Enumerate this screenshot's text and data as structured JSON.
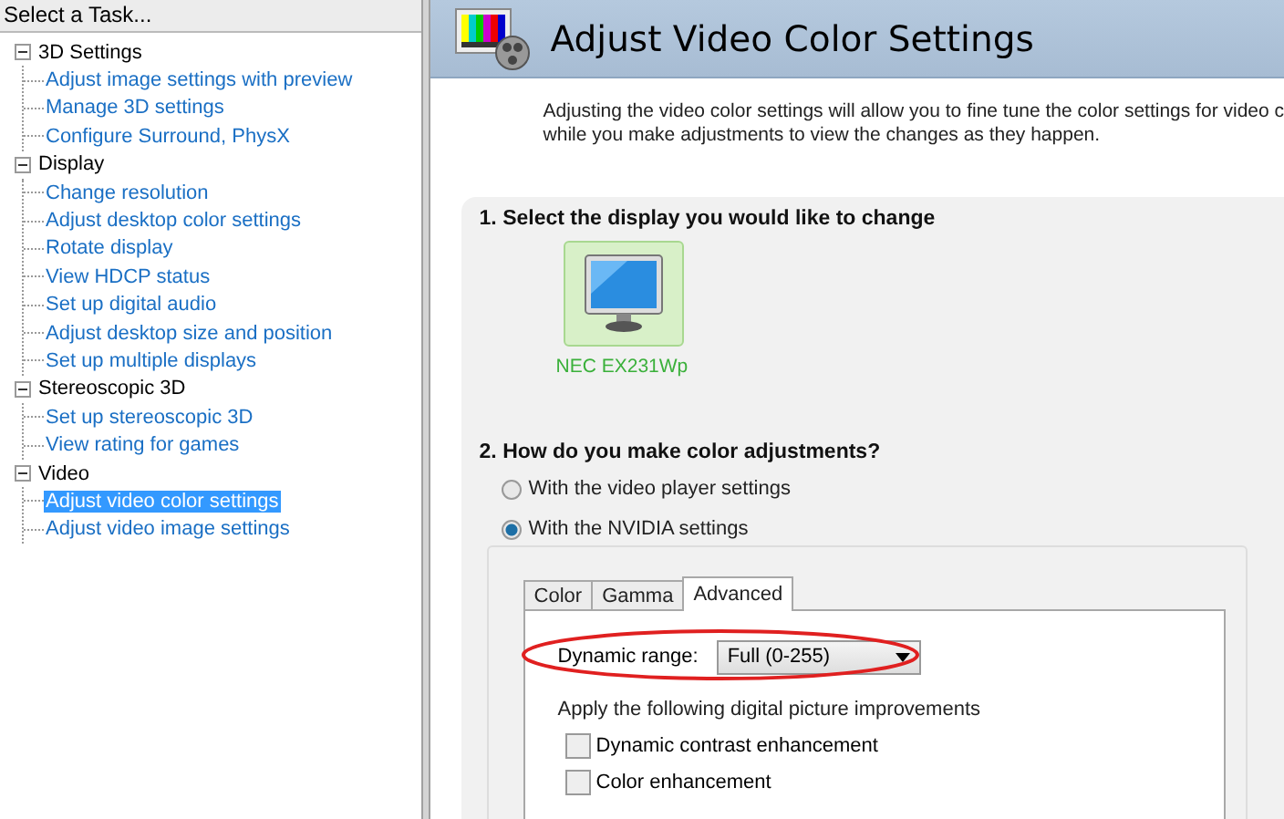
{
  "task_panel": {
    "title": "Select a Task...",
    "tree": [
      {
        "label": "3D Settings",
        "expanded": true,
        "children": [
          {
            "label": "Adjust image settings with preview",
            "selected": false
          },
          {
            "label": "Manage 3D settings",
            "selected": false
          },
          {
            "label": "Configure Surround, PhysX",
            "selected": false
          }
        ]
      },
      {
        "label": "Display",
        "expanded": true,
        "children": [
          {
            "label": "Change resolution",
            "selected": false
          },
          {
            "label": "Adjust desktop color settings",
            "selected": false
          },
          {
            "label": "Rotate display",
            "selected": false
          },
          {
            "label": "View HDCP status",
            "selected": false
          },
          {
            "label": "Set up digital audio",
            "selected": false
          },
          {
            "label": "Adjust desktop size and position",
            "selected": false
          },
          {
            "label": "Set up multiple displays",
            "selected": false
          }
        ]
      },
      {
        "label": "Stereoscopic 3D",
        "expanded": true,
        "children": [
          {
            "label": "Set up stereoscopic 3D",
            "selected": false
          },
          {
            "label": "View rating for games",
            "selected": false
          }
        ]
      },
      {
        "label": "Video",
        "expanded": true,
        "children": [
          {
            "label": "Adjust video color settings",
            "selected": true
          },
          {
            "label": "Adjust video image settings",
            "selected": false
          }
        ]
      }
    ]
  },
  "page": {
    "title": "Adjust Video Color Settings",
    "description": "Adjusting the video color settings will allow you to fine tune the color settings for video c\nwhile you make adjustments to view the changes as they happen.",
    "section_1": {
      "title": "1. Select the display you would like to change",
      "displays": [
        {
          "label": "NEC EX231Wp",
          "selected": true
        }
      ]
    },
    "section_2": {
      "title": "2. How do you make color adjustments?",
      "options": [
        {
          "label": "With the video player settings",
          "selected": false
        },
        {
          "label": "With the NVIDIA settings",
          "selected": true
        }
      ],
      "tabs": [
        {
          "label": "Color",
          "selected": false
        },
        {
          "label": "Gamma",
          "selected": false
        },
        {
          "label": "Advanced",
          "selected": true
        }
      ],
      "dynamic_range": {
        "label": "Dynamic range:",
        "value": "Full (0-255)"
      },
      "improvements_label": "Apply the following digital picture improvements",
      "checkboxes": [
        {
          "label": "Dynamic contrast enhancement",
          "checked": false
        },
        {
          "label": "Color enhancement",
          "checked": false
        }
      ]
    }
  }
}
